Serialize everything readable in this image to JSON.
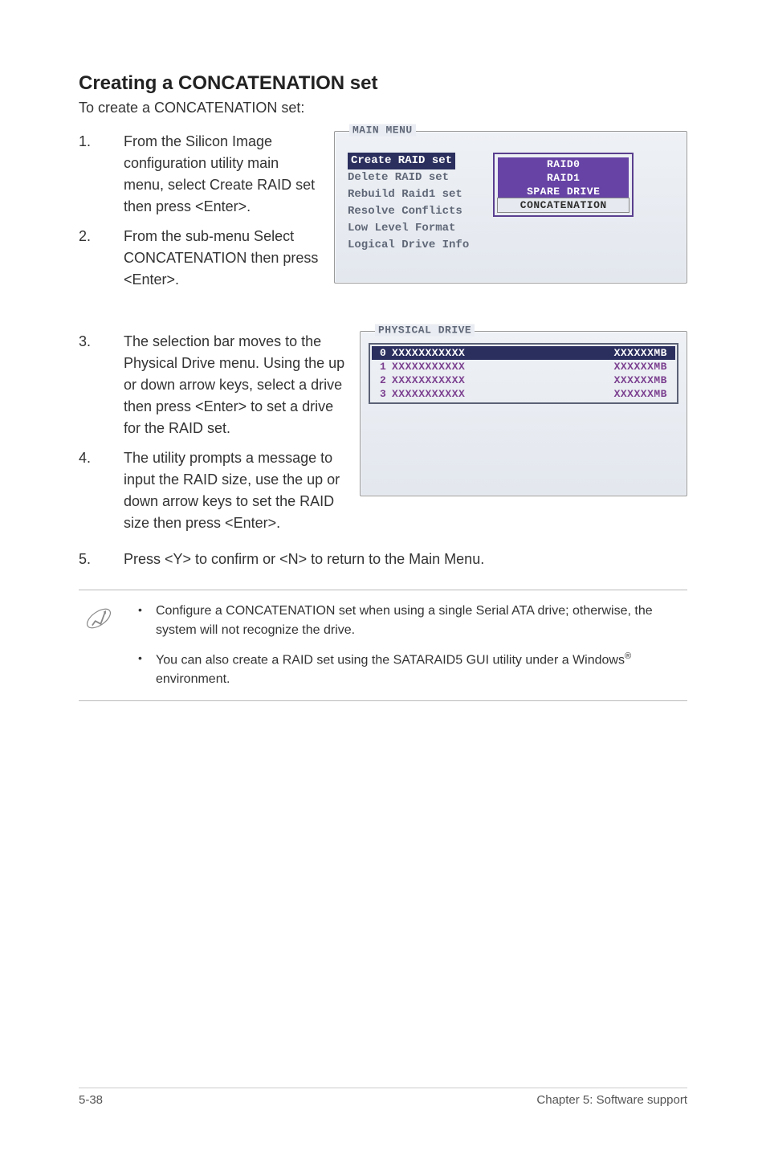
{
  "heading": "Creating a CONCATENATION set",
  "subtitle": "To create a CONCATENATION set:",
  "steps": {
    "s1": "From the Silicon Image configuration utility main menu, select Create RAID set then press <Enter>.",
    "s2": "From the sub-menu Select CONCATENATION then press <Enter>.",
    "s3": "The selection bar moves to the Physical Drive menu. Using the up or down arrow keys, select a drive then press <Enter> to set a drive for the RAID set.",
    "s4": "The utility prompts a message to input the RAID size, use the up or down arrow keys to set the RAID size then press <Enter>.",
    "s5": "Press <Y> to confirm or <N> to return to the Main Menu."
  },
  "main_menu": {
    "title": "MAIN MENU",
    "items": [
      "Create RAID set",
      "Delete RAID set",
      "Rebuild Raid1 set",
      "Resolve Conflicts",
      "Low Level Format",
      "Logical Drive Info"
    ],
    "submenu": [
      "RAID0",
      "RAID1",
      "SPARE DRIVE",
      "CONCATENATION"
    ]
  },
  "physical": {
    "title": "PHYSICAL DRIVE",
    "rows": [
      {
        "idx": "0",
        "name": "XXXXXXXXXXX",
        "size": "XXXXXXMB"
      },
      {
        "idx": "1",
        "name": "XXXXXXXXXXX",
        "size": "XXXXXXMB"
      },
      {
        "idx": "2",
        "name": "XXXXXXXXXXX",
        "size": "XXXXXXMB"
      },
      {
        "idx": "3",
        "name": "XXXXXXXXXXX",
        "size": "XXXXXXMB"
      }
    ]
  },
  "notes": {
    "n1": "Configure a CONCATENATION set when using a single Serial ATA drive; otherwise, the system will not recognize the drive.",
    "n2_pre": "You can also create a RAID set using the SATARAID5 GUI utility under a Windows",
    "n2_sup": "®",
    "n2_post": " environment."
  },
  "footer": {
    "left": "5-38",
    "right": "Chapter 5: Software support"
  }
}
